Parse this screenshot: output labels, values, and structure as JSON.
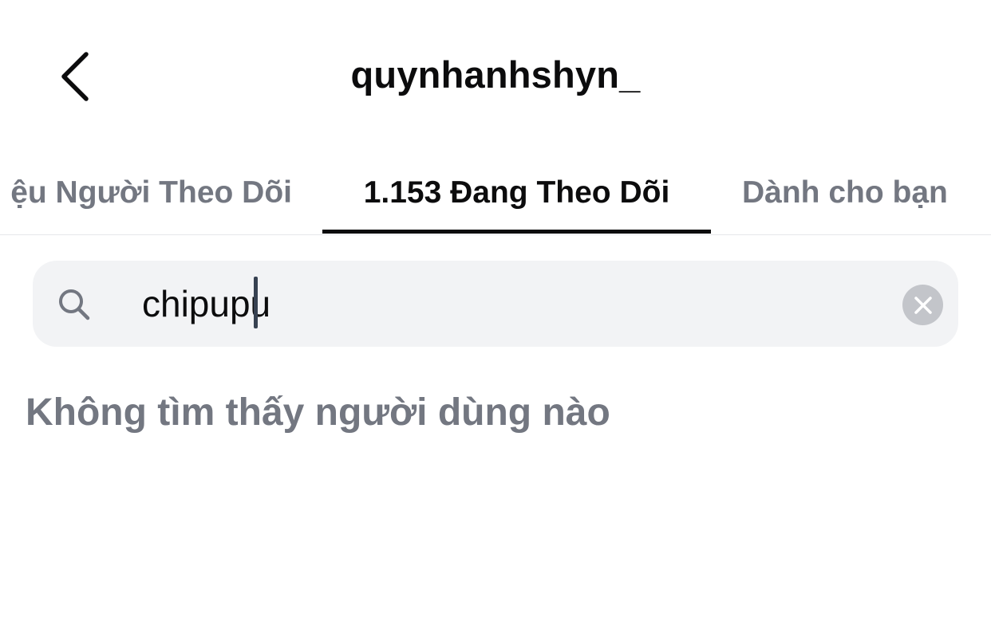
{
  "header": {
    "title": "quynhanhshyn_",
    "back_icon": "chevron-left-icon"
  },
  "tabs": [
    {
      "label": "ệu Người Theo Dõi",
      "active": false
    },
    {
      "label": "1.153 Đang Theo Dõi",
      "active": true
    },
    {
      "label": "Dành cho bạn",
      "active": false
    }
  ],
  "search": {
    "value": "chipupu",
    "icon": "search-icon",
    "clear_icon": "clear-icon"
  },
  "results": {
    "empty_message": "Không tìm thấy người dùng nào"
  },
  "colors": {
    "text_primary": "#0c0c0d",
    "text_secondary": "#737781",
    "search_bg": "#f2f3f5",
    "clear_bg": "#c3c5ca"
  }
}
